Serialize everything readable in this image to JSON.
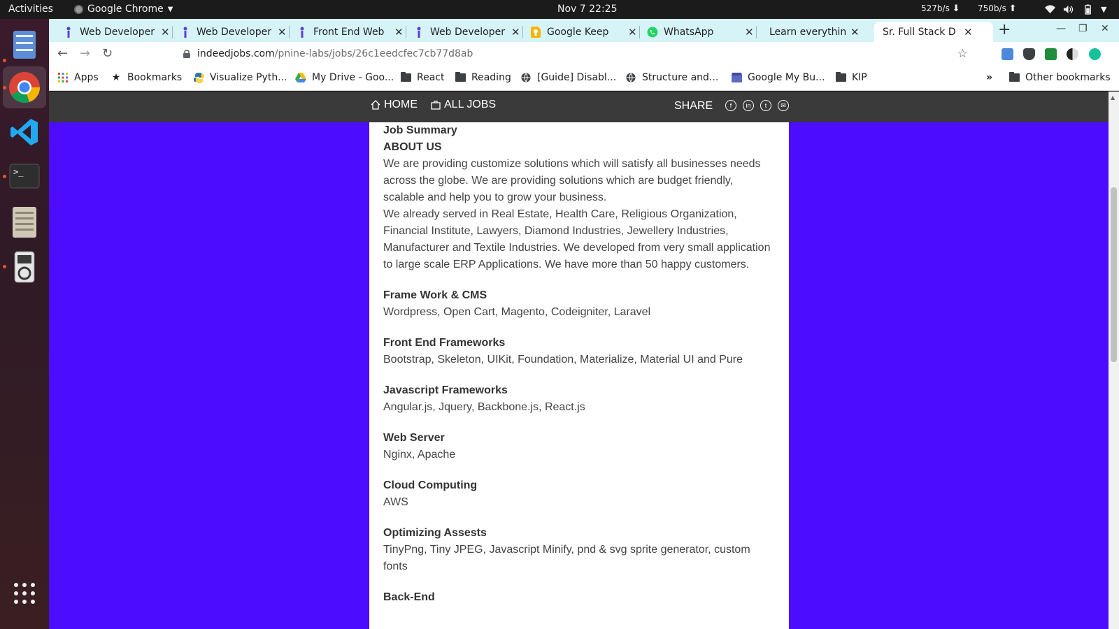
{
  "system": {
    "activities": "Activities",
    "app_name": "Google Chrome",
    "clock": "Nov 7  22:25",
    "net_down": "527b/s",
    "net_up": "750b/s"
  },
  "tabs": [
    {
      "title": "Web Developer",
      "favicon": "indeed-icon"
    },
    {
      "title": "Web Developer",
      "favicon": "indeed-icon"
    },
    {
      "title": "Front End Web",
      "favicon": "indeed-icon"
    },
    {
      "title": "Web Developer",
      "favicon": "indeed-icon"
    },
    {
      "title": "Google Keep",
      "favicon": "google-keep-icon"
    },
    {
      "title": "WhatsApp",
      "favicon": "whatsapp-icon"
    },
    {
      "title": "Learn everythin",
      "favicon": "none"
    },
    {
      "title": "Sr. Full Stack D",
      "favicon": "none",
      "active": true
    }
  ],
  "toolbar": {
    "url_host": "indeedjobs.com",
    "url_path": "/pnine-labs/jobs/26c1eedcfec7cb77d8ab"
  },
  "bookmarks": [
    {
      "label": "Apps",
      "icon": "apps-grid-icon"
    },
    {
      "label": "Bookmarks",
      "icon": "star-icon"
    },
    {
      "label": "Visualize Pyth...",
      "icon": "python-icon"
    },
    {
      "label": "My Drive - Goo...",
      "icon": "google-drive-icon"
    },
    {
      "label": "React",
      "icon": "folder-icon"
    },
    {
      "label": "Reading",
      "icon": "folder-icon"
    },
    {
      "label": "[Guide] Disabl...",
      "icon": "globe-icon"
    },
    {
      "label": "Structure and...",
      "icon": "globe-icon"
    },
    {
      "label": "Google My Bu...",
      "icon": "google-my-business-icon"
    },
    {
      "label": "KIP",
      "icon": "folder-icon"
    },
    {
      "label": "»",
      "icon": "none"
    },
    {
      "label": "Other bookmarks",
      "icon": "folder-icon"
    }
  ],
  "site_nav": {
    "home": "HOME",
    "all_jobs": "ALL JOBS",
    "share": "SHARE"
  },
  "job": {
    "summary_title": "Job Summary",
    "about_title": "ABOUT US",
    "about_p1": "We are providing customize solutions which will satisfy all businesses needs across the globe. We are providing solutions which are budget friendly, scalable and help you to grow your business.",
    "about_p2": "We already served in Real Estate, Health Care, Religious Organization, Financial Institute, Lawyers, Diamond Industries, Jewellery Industries, Manufacturer and Textile Industries. We developed from very small application to large scale ERP Applications. We have more than 50 happy customers.",
    "sections": [
      {
        "title": "Frame Work & CMS",
        "text": "Wordpress, Open Cart, Magento, Codeigniter, Laravel"
      },
      {
        "title": "Front End Frameworks",
        "text": "Bootstrap, Skeleton, UIKit, Foundation, Materialize, Material UI and Pure"
      },
      {
        "title": "Javascript Frameworks",
        "text": "Angular.js, Jquery, Backbone.js, React.js"
      },
      {
        "title": "Web Server",
        "text": "Nginx, Apache"
      },
      {
        "title": "Cloud Computing",
        "text": "AWS"
      },
      {
        "title": "Optimizing Assests",
        "text": "TinyPng, Tiny JPEG, Javascript Minify, pnd & svg sprite generator, custom fonts"
      },
      {
        "title": "Back-End",
        "text": ""
      }
    ]
  },
  "colors": {
    "page_background": "#4b0cff",
    "tab_strip": "#d6f4f7",
    "site_nav": "#3a3a3a"
  }
}
